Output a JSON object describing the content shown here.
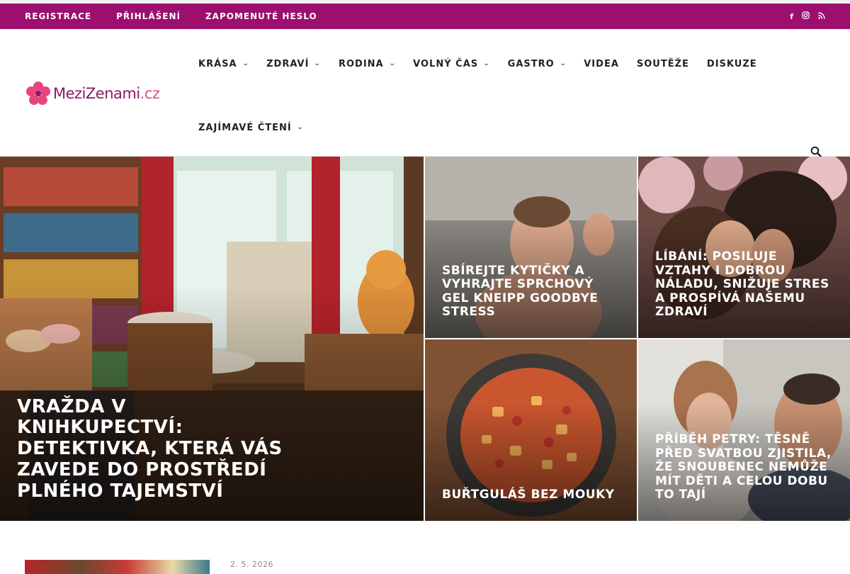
{
  "topbar": {
    "links": [
      "REGISTRACE",
      "PŘIHLÁŠENÍ",
      "ZAPOMENUTÉ HESLO"
    ],
    "social_icons": [
      "facebook-icon",
      "instagram-icon",
      "rss-icon"
    ],
    "background": "#9c0f6e"
  },
  "logo": {
    "name": "MeziZenami",
    "tld": ".cz"
  },
  "nav": {
    "items": [
      {
        "label": "KRÁSA",
        "has_dropdown": true
      },
      {
        "label": "ZDRAVÍ",
        "has_dropdown": true
      },
      {
        "label": "RODINA",
        "has_dropdown": true
      },
      {
        "label": "VOLNÝ ČAS",
        "has_dropdown": true
      },
      {
        "label": "GASTRO",
        "has_dropdown": true
      },
      {
        "label": "VIDEA",
        "has_dropdown": false
      },
      {
        "label": "SOUTĚŽE",
        "has_dropdown": false
      },
      {
        "label": "DISKUZE",
        "has_dropdown": false
      },
      {
        "label": "ZAJÍMAVÉ ČTENÍ",
        "has_dropdown": true
      }
    ],
    "chevron": "⌄",
    "search_icon": "search-icon"
  },
  "featured": [
    {
      "title": "VRAŽDA V KNIHKUPECTVÍ: DETEKTIVKA, KTERÁ VÁS ZAVEDE DO PROSTŘEDÍ PLNÉHO TAJEMSTVÍ"
    },
    {
      "title": "SBÍREJTE KYTIČKY A VYHRAJTE SPRCHOVÝ GEL KNEIPP GOODBYE STRESS"
    },
    {
      "title": "LÍBÁNÍ: POSILUJE VZTAHY I DOBROU NÁLADU, SNIŽUJE STRES A PROSPÍVÁ NAŠEMU ZDRAVÍ"
    },
    {
      "title": "BUŘTGULÁŠ BEZ MOUKY"
    },
    {
      "title": "PŘÍBĚH PETRY: TĚSNĚ PŘED SVATBOU ZJISTILA, ŽE SNOUBENEC NEMŮŽE MÍT DĚTI A CELOU DOBU TO TAJÍ"
    }
  ],
  "latest": {
    "date": "2. 5. 2026"
  },
  "colors": {
    "accent": "#9c0f6e",
    "logo_text": "#8a1a63",
    "logo_tld": "#d84f93"
  }
}
